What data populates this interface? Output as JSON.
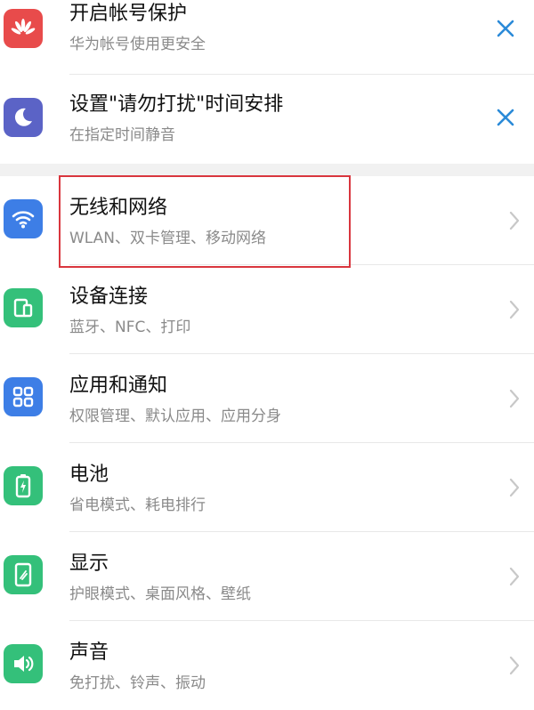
{
  "suggestions": [
    {
      "title": "开启帐号保护",
      "subtitle": "华为帐号使用更安全",
      "icon": "huawei-logo-icon",
      "color": "#e84b4b"
    },
    {
      "title": "设置\"请勿打扰\"时间安排",
      "subtitle": "在指定时间静音",
      "icon": "moon-icon",
      "color": "#5b63c6"
    }
  ],
  "settings": [
    {
      "title": "无线和网络",
      "subtitle": "WLAN、双卡管理、移动网络",
      "icon": "wifi-icon",
      "color": "#3d7ee6"
    },
    {
      "title": "设备连接",
      "subtitle": "蓝牙、NFC、打印",
      "icon": "device-connection-icon",
      "color": "#34c07a"
    },
    {
      "title": "应用和通知",
      "subtitle": "权限管理、默认应用、应用分身",
      "icon": "apps-grid-icon",
      "color": "#3d7ee6"
    },
    {
      "title": "电池",
      "subtitle": "省电模式、耗电排行",
      "icon": "battery-icon",
      "color": "#34c07a"
    },
    {
      "title": "显示",
      "subtitle": "护眼模式、桌面风格、壁纸",
      "icon": "display-icon",
      "color": "#34c07a"
    },
    {
      "title": "声音",
      "subtitle": "免打扰、铃声、振动",
      "icon": "speaker-icon",
      "color": "#34c07a"
    }
  ],
  "colors": {
    "close": "#2a8ad8",
    "chevron": "#c8c8c8",
    "highlight": "#d9363e"
  }
}
